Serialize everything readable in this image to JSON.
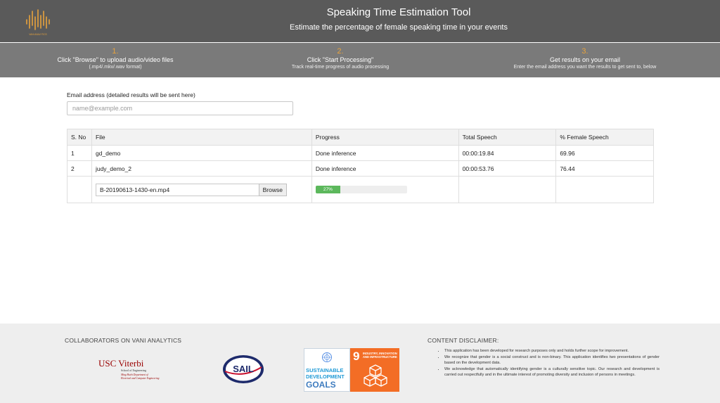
{
  "header": {
    "logo_caption": "VANI ANALYTICS",
    "title": "Speaking Time Estimation Tool",
    "subtitle": "Estimate the percentage of female speaking time in your events"
  },
  "steps": [
    {
      "num": "1.",
      "title": "Click \"Browse\" to upload audio/video files",
      "desc": "(.mp4/.mkv/.wav format)"
    },
    {
      "num": "2.",
      "title": "Click \"Start Processing\"",
      "desc": "Track real-time progress of audio processing"
    },
    {
      "num": "3.",
      "title": "Get results on your email",
      "desc": "Enter the email address you want the results to get sent to, below"
    }
  ],
  "email": {
    "label": "Email address (detailed results will be sent here)",
    "placeholder": "name@example.com",
    "value": ""
  },
  "table": {
    "headers": [
      "S. No",
      "File",
      "Progress",
      "Total Speech",
      "% Female Speech"
    ],
    "rows": [
      {
        "sno": "1",
        "file": "gd_demo",
        "progress": "Done inference",
        "total": "00:00:19.84",
        "female": "69.96"
      },
      {
        "sno": "2",
        "file": "judy_demo_2",
        "progress": "Done inference",
        "total": "00:00:53.76",
        "female": "76.44"
      }
    ],
    "upload_row": {
      "file_name": "B-20190613-1430-en.mp4",
      "browse_label": "Browse",
      "progress_percent": 27,
      "progress_label": "27%"
    }
  },
  "footer": {
    "collab_title": "COLLABORATORS ON VANI ANALYTICS",
    "usc_line1": "USC Viterbi",
    "usc_line2": "School of Engineering",
    "usc_line3": "Ming Hsieh Department of",
    "usc_line4": "Electrical and Computer Engineering",
    "sail_text": "SAIL",
    "sdg_word1": "SUSTAINABLE",
    "sdg_word2": "DEVELOPMENT",
    "sdg_word3": "GOALS",
    "sdg_number": "9",
    "sdg_goal": "INDUSTRY, INNOVATION AND INFRASTRUCTURE",
    "disclaimer_title": "CONTENT DISCLAIMER:",
    "disclaimer_items": [
      "This application has been developed for research purposes only and holds further scope for improvement.",
      "We recognize that gender is a social construct and is non-binary. This application identifies two presentations of gender based on the development data.",
      "We acknowledge that automatically identifying gender is a culturally sensitive topic. Our research and development is carried out respectfully and in the ultimate interest of promoting diversity and inclusion of persons in meetings."
    ]
  },
  "colors": {
    "header_bg": "#5a5a5a",
    "steps_bg": "#7a7a7a",
    "accent_orange": "#e8a33c",
    "progress_green": "#5cb85c",
    "sdg_orange": "#f36d25"
  }
}
